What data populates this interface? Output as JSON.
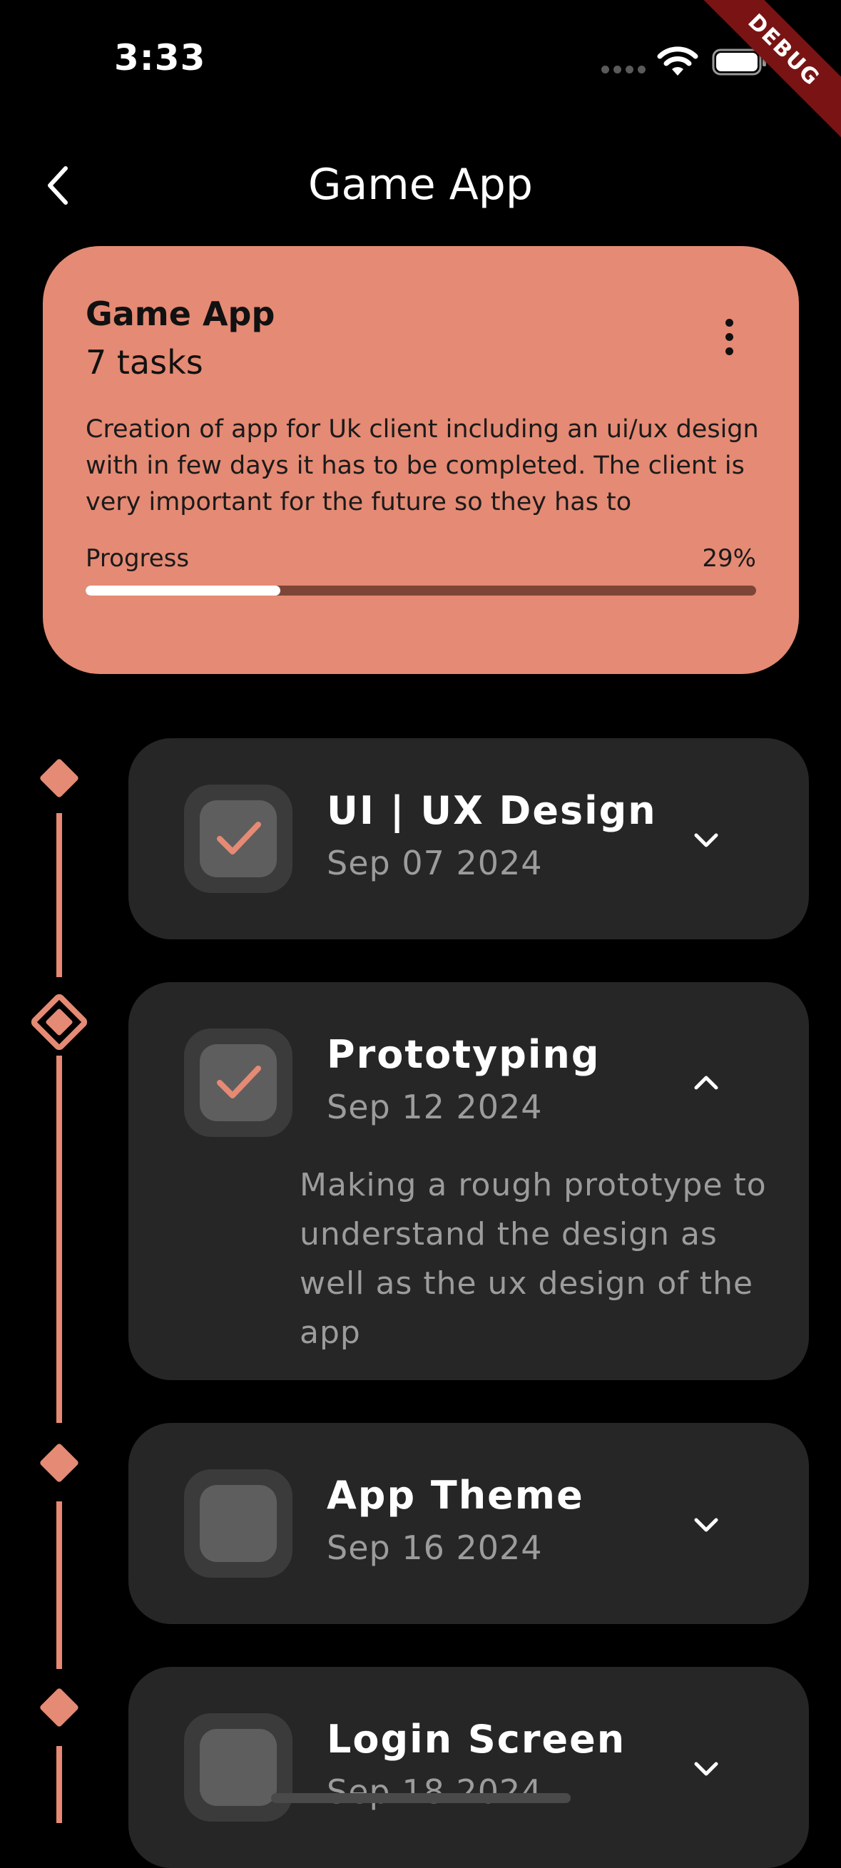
{
  "status_bar": {
    "time": "3:33",
    "debug_label": "DEBUG"
  },
  "header": {
    "title": "Game App"
  },
  "project": {
    "title": "Game App",
    "task_count": "7 tasks",
    "description": "Creation of app for Uk client including an ui/ux design with  in few days it has to be completed. The client is very important for the future so they has to",
    "progress_label": "Progress",
    "progress_text": "29%",
    "progress_fraction": 0.29
  },
  "tasks": [
    {
      "title": "UI | UX Design",
      "date": "Sep 07 2024",
      "completed": true,
      "expanded": false
    },
    {
      "title": "Prototyping",
      "date": "Sep 12 2024",
      "completed": true,
      "expanded": true,
      "description": "Making a rough prototype to understand the design as well as the ux design of the app"
    },
    {
      "title": "App Theme",
      "date": "Sep 16 2024",
      "completed": false,
      "expanded": false
    },
    {
      "title": "Login Screen",
      "date": "Sep 18 2024",
      "completed": false,
      "expanded": false
    }
  ],
  "colors": {
    "accent": "#e58a74",
    "card": "#262626",
    "background": "#000000"
  }
}
